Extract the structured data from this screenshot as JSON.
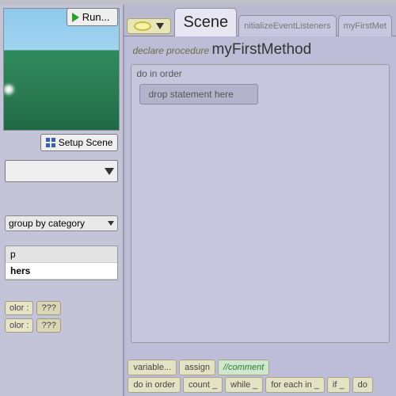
{
  "left": {
    "run_label": "Run...",
    "setup_label": "Setup Scene",
    "group_label": "group by category",
    "categories": [
      "p",
      "hers"
    ],
    "tiles": {
      "olor_label": "olor :",
      "q": "???"
    }
  },
  "tabs": {
    "scene": "Scene",
    "init": "nitializeEventListeners",
    "myfirst": "myFirstMet"
  },
  "declaration": {
    "prefix": "declare procedure",
    "name": "myFirstMethod"
  },
  "editor": {
    "do_in_order": "do in order",
    "drop_hint": "drop statement here"
  },
  "controls": {
    "do_in_order": "do in order",
    "count": "count _",
    "while": "while _",
    "for_each": "for each in _",
    "if": "if _",
    "do": "do",
    "variable": "variable...",
    "assign": "assign",
    "comment": "//comment"
  }
}
